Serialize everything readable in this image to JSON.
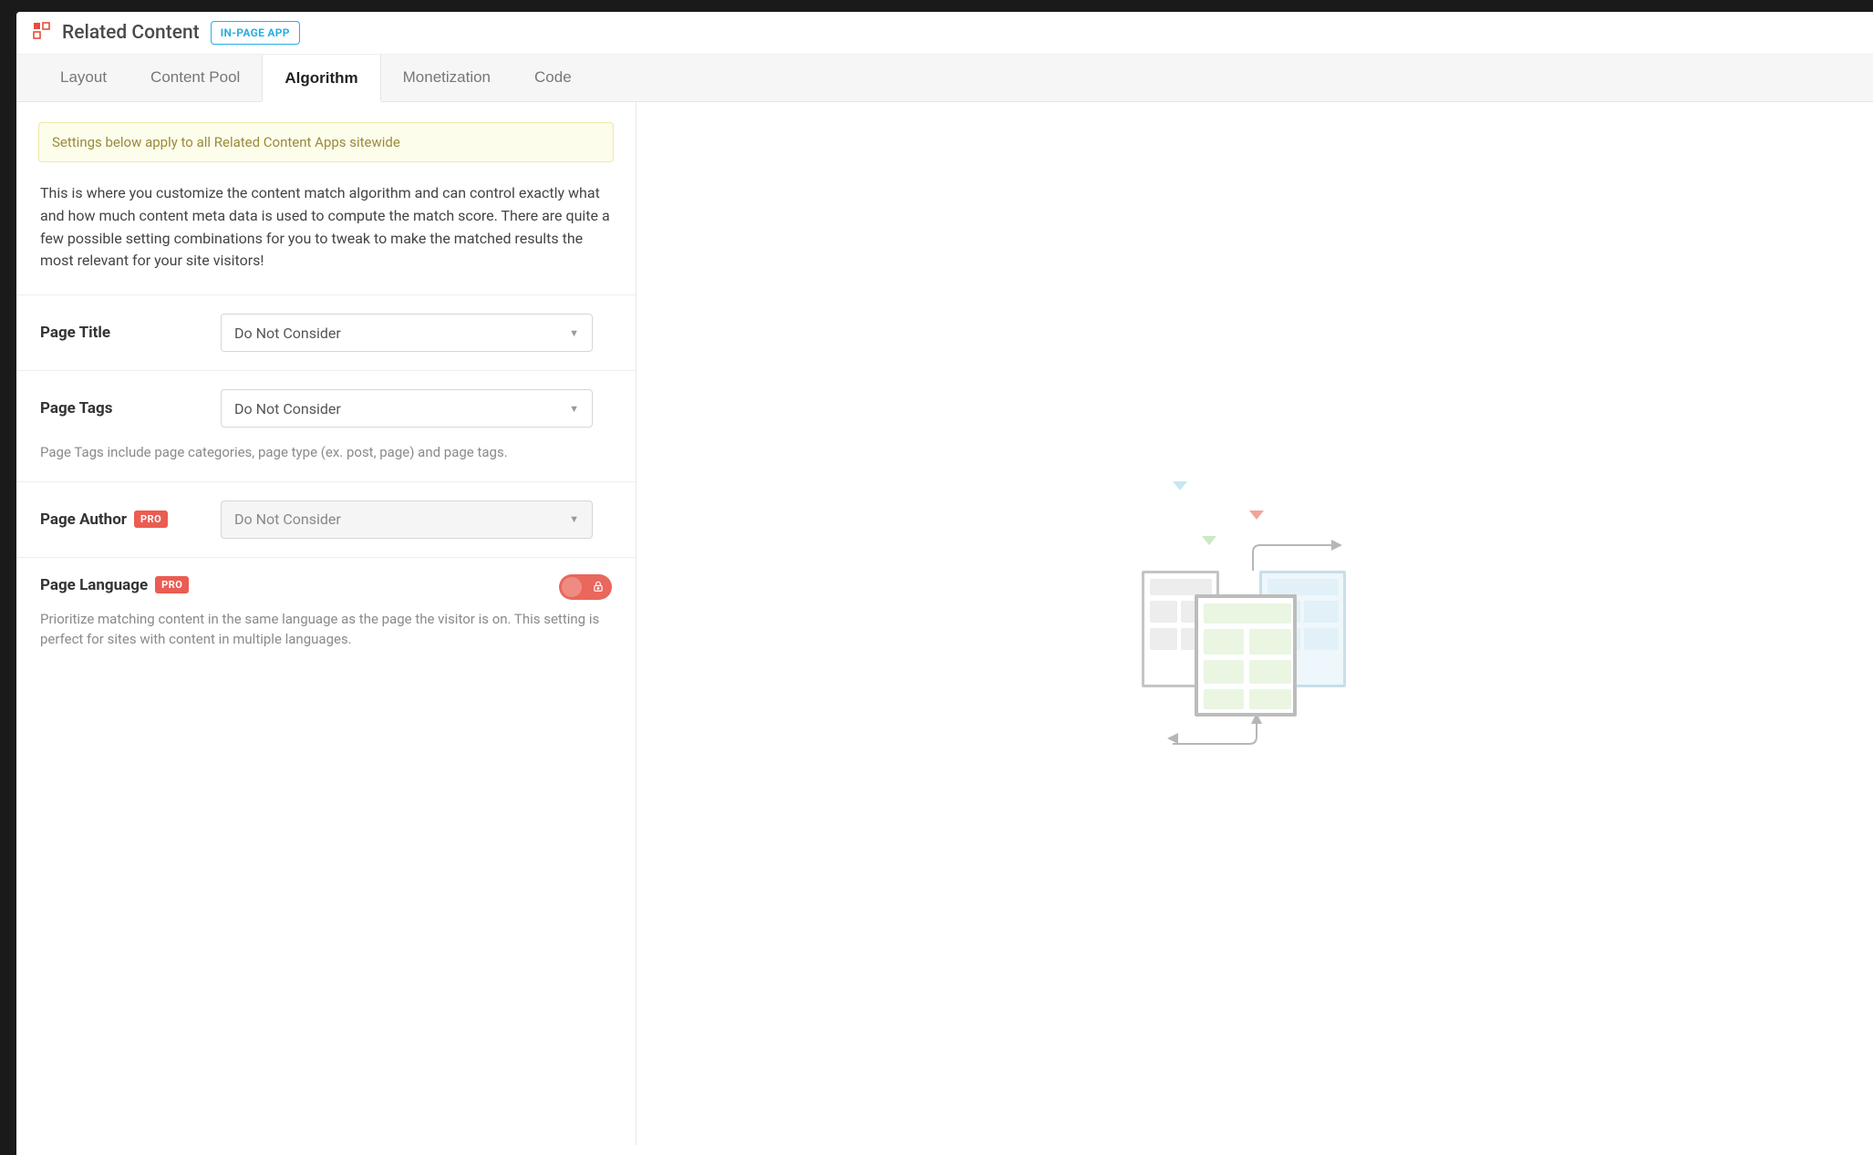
{
  "header": {
    "title": "Related Content",
    "badge": "IN-PAGE APP"
  },
  "tabs": [
    {
      "label": "Layout",
      "active": false
    },
    {
      "label": "Content Pool",
      "active": false
    },
    {
      "label": "Algorithm",
      "active": true
    },
    {
      "label": "Monetization",
      "active": false
    },
    {
      "label": "Code",
      "active": false
    }
  ],
  "notice": "Settings below apply to all Related Content Apps sitewide",
  "description": "This is where you customize the content match algorithm and can control exactly what and how much content meta data is used to compute the match score. There are quite a few possible setting combinations for you to tweak to make the matched results the most relevant for your site visitors!",
  "settings": {
    "page_title": {
      "label": "Page Title",
      "value": "Do Not Consider"
    },
    "page_tags": {
      "label": "Page Tags",
      "value": "Do Not Consider",
      "hint": "Page Tags include page categories, page type (ex. post, page) and page tags."
    },
    "page_author": {
      "label": "Page Author",
      "pro": "PRO",
      "value": "Do Not Consider"
    },
    "page_language": {
      "label": "Page Language",
      "pro": "PRO",
      "hint": "Prioritize matching content in the same language as the page the visitor is on. This setting is perfect for sites with content in multiple languages."
    }
  }
}
